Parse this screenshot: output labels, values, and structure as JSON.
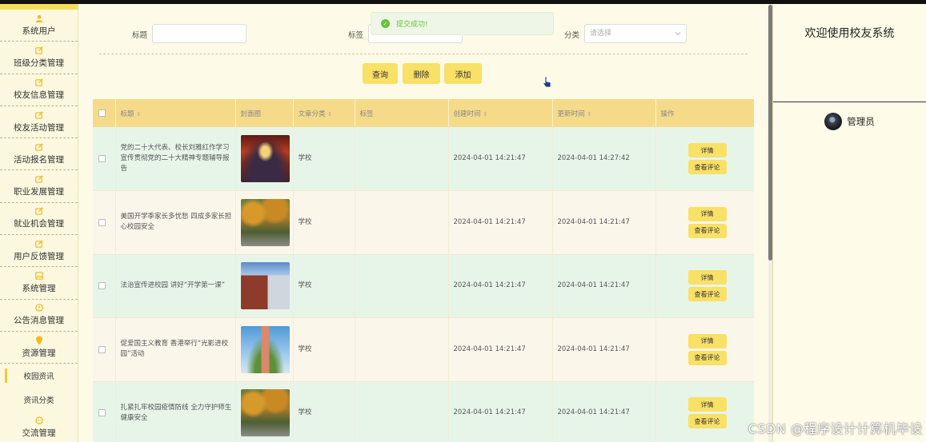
{
  "sidebar": {
    "items": [
      {
        "label": "系统用户",
        "icon": "user-icon"
      },
      {
        "label": "班级分类管理",
        "icon": "edit-icon"
      },
      {
        "label": "校友信息管理",
        "icon": "edit-icon"
      },
      {
        "label": "校友活动管理",
        "icon": "edit-icon"
      },
      {
        "label": "活动报名管理",
        "icon": "edit-icon"
      },
      {
        "label": "职业发展管理",
        "icon": "edit-icon"
      },
      {
        "label": "就业机会管理",
        "icon": "edit-icon"
      },
      {
        "label": "用户反馈管理",
        "icon": "edit-icon"
      },
      {
        "label": "系统管理",
        "icon": "image-icon"
      },
      {
        "label": "公告消息管理",
        "icon": "info-icon"
      },
      {
        "label": "资源管理",
        "icon": "pin-icon"
      }
    ],
    "subitems": [
      {
        "label": "校园资讯",
        "active": true
      },
      {
        "label": "资讯分类",
        "active": false
      }
    ],
    "last_item": {
      "label": "交流管理",
      "icon": "chat-icon"
    }
  },
  "search": {
    "title_label": "标题",
    "tag_label": "标签",
    "category_label": "分类",
    "category_placeholder": "请选择"
  },
  "toolbar": {
    "query": "查询",
    "delete": "删除",
    "add": "添加"
  },
  "toast": {
    "message": "提交成功!"
  },
  "table": {
    "headers": {
      "title": "标题",
      "cover": "封面图",
      "category": "文章分类",
      "tag": "标签",
      "created": "创建时间",
      "updated": "更新时间",
      "action": "操作"
    },
    "rows": [
      {
        "title": "党的二十大代表、校长刘雅红作学习宣传贯彻党的二十大精神专题辅导报告",
        "category": "学校",
        "tag": "",
        "created": "2024-04-01 14:21:47",
        "updated": "2024-04-01 14:27:42",
        "img": "hall"
      },
      {
        "title": "美国开学季家长多忧愁 四成多家长担心校园安全",
        "category": "学校",
        "tag": "",
        "created": "2024-04-01 14:21:47",
        "updated": "2024-04-01 14:21:47",
        "img": "autumn"
      },
      {
        "title": "法治宣传进校园 讲好“开学第一课”",
        "category": "学校",
        "tag": "",
        "created": "2024-04-01 14:21:47",
        "updated": "2024-04-01 14:21:47",
        "img": "campus"
      },
      {
        "title": "促爱国主义教育 香港举行“光影进校园”活动",
        "category": "学校",
        "tag": "",
        "created": "2024-04-01 14:21:47",
        "updated": "2024-04-01 14:21:47",
        "img": "tower"
      },
      {
        "title": "扎紧扎牢校园疫情防线 全力守护师生健康安全",
        "category": "学校",
        "tag": "",
        "created": "2024-04-01 14:21:47",
        "updated": "2024-04-01 14:21:47",
        "img": "autumn"
      }
    ],
    "detail_label": "详情",
    "comment_label": "查看评论"
  },
  "rpanel": {
    "welcome": "欢迎使用校友系统",
    "admin": "管理员"
  },
  "watermark": "CSDN @程序设计计算机毕设"
}
